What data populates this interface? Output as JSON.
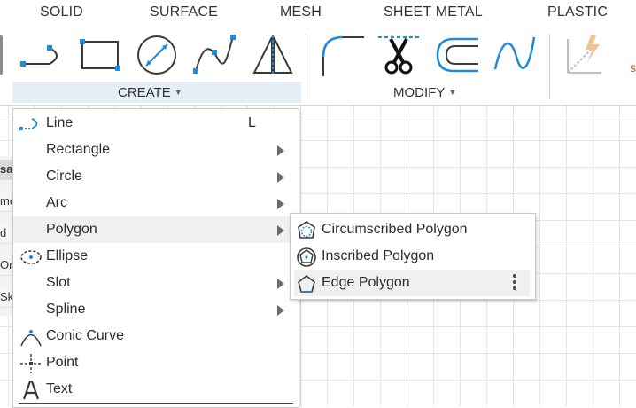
{
  "toolbar": {
    "tabs": [
      "SOLID",
      "SURFACE",
      "MESH",
      "SHEET METAL",
      "PLASTIC"
    ],
    "groups": {
      "create": "CREATE",
      "modify": "MODIFY"
    },
    "create_tools": [
      "line-tool-icon",
      "rectangle-tool-icon",
      "circle-tool-icon",
      "spline-tool-icon",
      "mirror-tool-icon"
    ],
    "modify_tools": [
      "fillet-tool-icon",
      "trim-tool-icon",
      "offset-tool-icon",
      "spline-curve-tool-icon"
    ]
  },
  "browser": {
    "rows": [
      "sa",
      "me",
      "d",
      "Ori",
      "Sk"
    ]
  },
  "create_menu": {
    "items": [
      {
        "label": "Line",
        "shortcut": "L",
        "icon": "line-icon",
        "submenu": false
      },
      {
        "label": "Rectangle",
        "shortcut": "",
        "icon": "",
        "submenu": true
      },
      {
        "label": "Circle",
        "shortcut": "",
        "icon": "",
        "submenu": true
      },
      {
        "label": "Arc",
        "shortcut": "",
        "icon": "",
        "submenu": true
      },
      {
        "label": "Polygon",
        "shortcut": "",
        "icon": "",
        "submenu": true
      },
      {
        "label": "Ellipse",
        "shortcut": "",
        "icon": "ellipse-icon",
        "submenu": false
      },
      {
        "label": "Slot",
        "shortcut": "",
        "icon": "",
        "submenu": true
      },
      {
        "label": "Spline",
        "shortcut": "",
        "icon": "",
        "submenu": true
      },
      {
        "label": "Conic Curve",
        "shortcut": "",
        "icon": "conic-curve-icon",
        "submenu": false
      },
      {
        "label": "Point",
        "shortcut": "",
        "icon": "point-icon",
        "submenu": false
      },
      {
        "label": "Text",
        "shortcut": "",
        "icon": "text-icon",
        "submenu": false
      }
    ]
  },
  "polygon_submenu": {
    "items": [
      {
        "label": "Circumscribed Polygon",
        "icon": "circumscribed-polygon-icon"
      },
      {
        "label": "Inscribed Polygon",
        "icon": "inscribed-polygon-icon"
      },
      {
        "label": "Edge Polygon",
        "icon": "edge-polygon-icon"
      }
    ]
  },
  "colors": {
    "accent": "#1f8ad8",
    "icon_dark": "#3a3a3a",
    "group_bar": "#e5eef7",
    "highlight": "#f0f0f0"
  }
}
